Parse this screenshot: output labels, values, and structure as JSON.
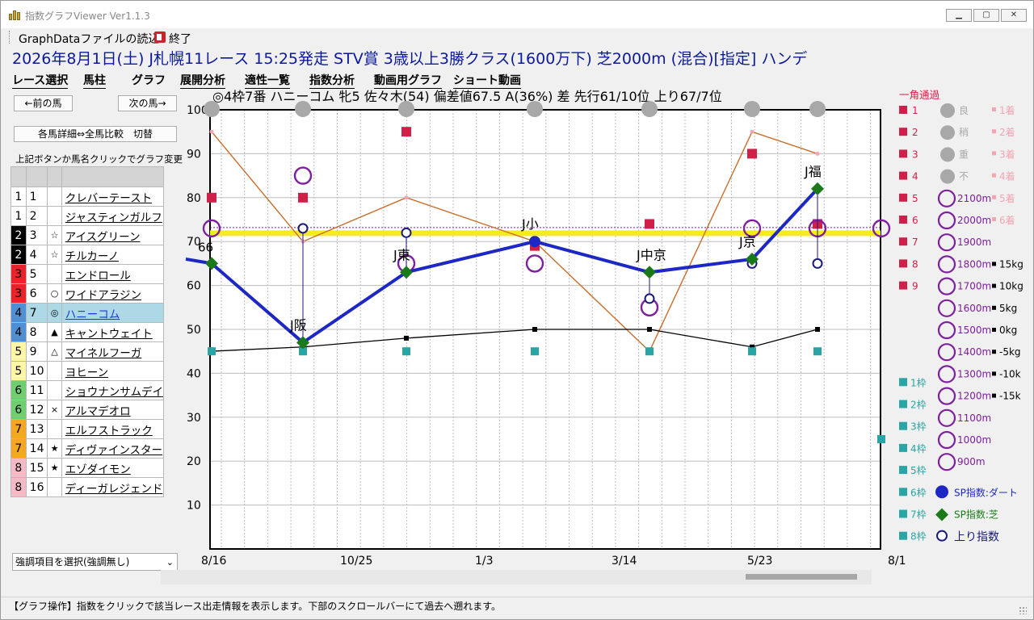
{
  "window": {
    "title": "指数グラフViewer Ver1.1.3"
  },
  "menu": {
    "load": "GraphDataファイルの読込",
    "exit": "終了"
  },
  "race_title": "2026年8月1日(土) J札幌11レース 15:25発走 STV賞 3歳以上3勝クラス(1600万下) 芝2000m (混合)[指定] ハンデ",
  "tabs": [
    "レース選択",
    "馬柱",
    "グラフ",
    "展開分析",
    "適性一覧",
    "指数分析",
    "動画用グラフ",
    "ショート動画"
  ],
  "nav": {
    "prev": "←前の馬",
    "next": "次の馬→",
    "toggle": "各馬詳細⇔全馬比較　切替",
    "hint": "上記ボタンか馬名クリックでグラフ変更"
  },
  "horses": [
    {
      "waku": "1",
      "num": "1",
      "mark": "",
      "name": "クレバーテースト"
    },
    {
      "waku": "1",
      "num": "2",
      "mark": "",
      "name": "ジャスティンガルフ"
    },
    {
      "waku": "2",
      "num": "3",
      "mark": "☆",
      "name": "アイスグリーン"
    },
    {
      "waku": "2",
      "num": "4",
      "mark": "☆",
      "name": "チルカーノ"
    },
    {
      "waku": "3",
      "num": "5",
      "mark": "",
      "name": "エンドロール"
    },
    {
      "waku": "3",
      "num": "6",
      "mark": "○",
      "name": "ワイドアラジン"
    },
    {
      "waku": "4",
      "num": "7",
      "mark": "◎",
      "name": "ハニーコム"
    },
    {
      "waku": "4",
      "num": "8",
      "mark": "▲",
      "name": "キャントウェイト"
    },
    {
      "waku": "5",
      "num": "9",
      "mark": "△",
      "name": "マイネルフーガ"
    },
    {
      "waku": "5",
      "num": "10",
      "mark": "",
      "name": "ヨヒーン"
    },
    {
      "waku": "6",
      "num": "11",
      "mark": "",
      "name": "ショウナンサムデイ"
    },
    {
      "waku": "6",
      "num": "12",
      "mark": "×",
      "name": "アルマデオロ"
    },
    {
      "waku": "7",
      "num": "13",
      "mark": "",
      "name": "エルフストラック"
    },
    {
      "waku": "7",
      "num": "14",
      "mark": "★",
      "name": "ディヴァインスター"
    },
    {
      "waku": "8",
      "num": "15",
      "mark": "★",
      "name": "エゾダイモン"
    },
    {
      "waku": "8",
      "num": "16",
      "mark": "",
      "name": "ディーガレジェンド"
    }
  ],
  "waku_colors": {
    "1": {
      "bg": "#ffffff",
      "fg": "#000000"
    },
    "2": {
      "bg": "#000000",
      "fg": "#ffffff"
    },
    "3": {
      "bg": "#e8232a",
      "fg": "#000000"
    },
    "4": {
      "bg": "#4f8fd6",
      "fg": "#000000"
    },
    "5": {
      "bg": "#fff6a8",
      "fg": "#000000"
    },
    "6": {
      "bg": "#6fcf6f",
      "fg": "#000000"
    },
    "7": {
      "bg": "#f5a623",
      "fg": "#000000"
    },
    "8": {
      "bg": "#f6b9c6",
      "fg": "#000000"
    }
  },
  "selected_num": "7",
  "emphasis_select": "強調項目を選択(強調無し)",
  "status": "【グラフ操作】指数をクリックで該当レース出走情報を表示します。下部のスクロールバーにて過去へ遡れます。",
  "chart_data": {
    "type": "line",
    "header": "◎4枠7番 ハニーコム 牝5 佐々木(54) 偏差値67.5 A(36%) 差 先行61/10位 上り67/7位",
    "ylim": [
      0,
      100
    ],
    "yticks": [
      10,
      20,
      30,
      40,
      50,
      60,
      70,
      80,
      90,
      100
    ],
    "xtick_labels": [
      "8/16",
      "10/25",
      "1/3",
      "3/14",
      "5/23",
      "8/1"
    ],
    "reference_level": 73,
    "colors": {
      "sp": "#1d28c4",
      "sp_turf": "#1a7a1a",
      "agari": "#1a1a80",
      "pos": "#c96d2a",
      "finish": "#d01f48",
      "gate": "#2aa5a5",
      "dist": "#7d1f9e",
      "weight": "#111111",
      "cond": "#a8a8a8",
      "cond_label": "#f3a5b3",
      "ref": "#f5ec1e"
    },
    "races": [
      {
        "venue": "",
        "sp": 65,
        "surface": "芝",
        "agari": null,
        "position": 95,
        "finish": 80,
        "gate": 45,
        "weight_level": null,
        "dist_circle": 73,
        "cond": 100
      },
      {
        "venue": "J阪",
        "sp": 47,
        "surface": "芝",
        "agari": 73,
        "position": 70,
        "finish": 80,
        "gate": 45,
        "weight_level": 46,
        "dist_circle": 85,
        "cond": 100
      },
      {
        "venue": "J東",
        "sp": 63,
        "surface": "芝",
        "agari": 72,
        "position": 80,
        "finish": 95,
        "gate": 45,
        "weight_level": 48,
        "dist_circle": 65,
        "cond": 100
      },
      {
        "venue": "J小",
        "sp": 70,
        "surface": "ダート",
        "agari": 70,
        "position": 70,
        "finish": 69,
        "gate": 45,
        "weight_level": 50,
        "dist_circle": 65,
        "cond": 100
      },
      {
        "venue": "J中京",
        "sp": 63,
        "surface": "芝",
        "agari": 57,
        "position": 45,
        "finish": 74,
        "gate": 45,
        "weight_level": 50,
        "dist_circle": 55,
        "cond": 100
      },
      {
        "venue": "J京",
        "sp": 66,
        "surface": "芝",
        "agari": 65,
        "position": 95,
        "finish": 90,
        "gate": 45,
        "weight_level": 46,
        "dist_circle": 73,
        "cond": 100
      },
      {
        "venue": "J福",
        "sp": 82,
        "surface": "芝",
        "agari": 65,
        "position": 90,
        "finish": 74,
        "gate": 45,
        "weight_level": 50,
        "dist_circle": 73,
        "cond": 100
      }
    ],
    "sp_first_label": "66",
    "today": {
      "dist_circle": 73,
      "gate": 25
    },
    "legend": {
      "header": "一角通過",
      "finish": [
        "1",
        "2",
        "3",
        "4",
        "5",
        "6",
        "7",
        "8",
        "9"
      ],
      "cond": [
        "良",
        "稍",
        "重",
        "不"
      ],
      "cond_finish": [
        "1着",
        "2着",
        "3着",
        "4着",
        "5着",
        "6着"
      ],
      "distance": [
        "2100m",
        "2000m",
        "1900m",
        "1800m",
        "1700m",
        "1600m",
        "1500m",
        "1400m",
        "1300m",
        "1200m",
        "1100m",
        "1000m",
        "900m"
      ],
      "weight": [
        "15kg",
        "10kg",
        "5kg",
        "0kg",
        "-5kg",
        "-10k",
        "-15k"
      ],
      "gate": [
        "1枠",
        "2枠",
        "3枠",
        "4枠",
        "5枠",
        "6枠",
        "7枠",
        "8枠"
      ],
      "sp_dirt": "SP指数:ダート",
      "sp_turf": "SP指数:芝",
      "agari": "上り指数"
    }
  }
}
